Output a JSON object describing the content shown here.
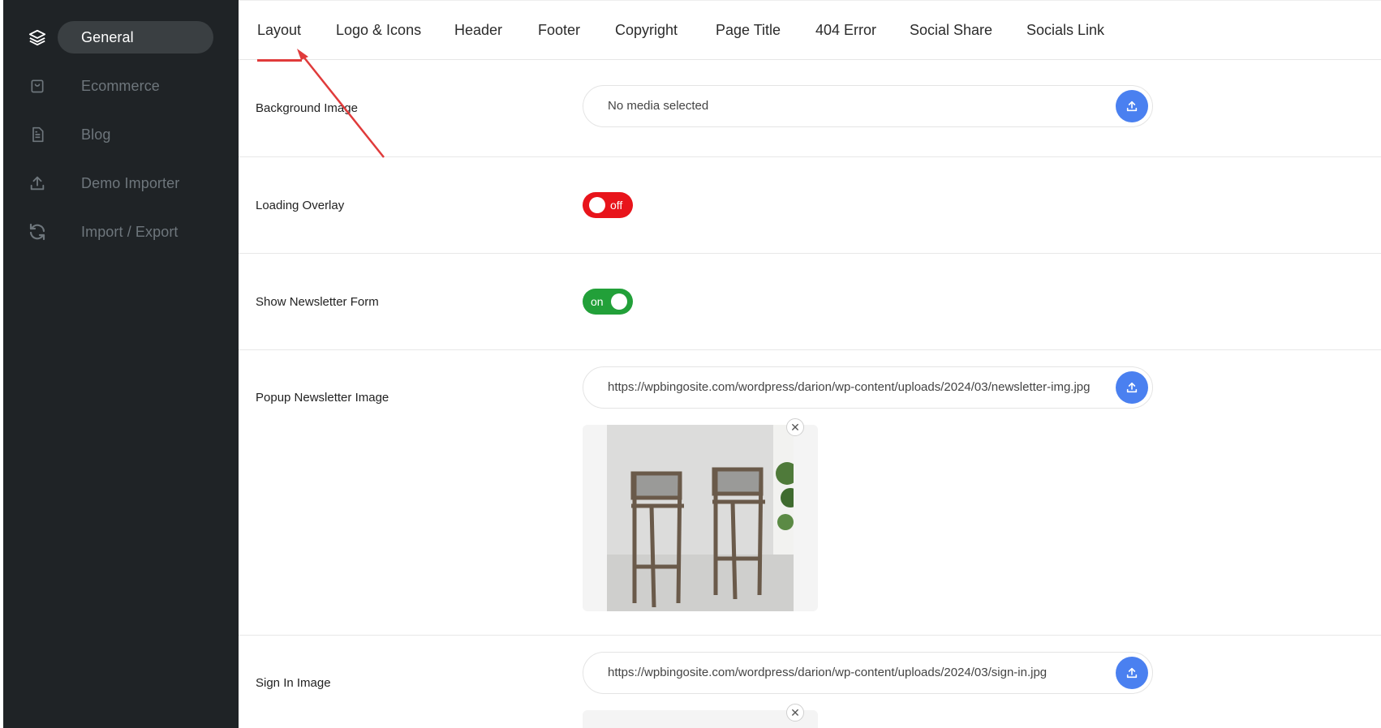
{
  "sidebar": {
    "items": [
      {
        "label": "General",
        "icon": "layers-icon",
        "active": true
      },
      {
        "label": "Ecommerce",
        "icon": "shopping-bag-icon",
        "active": false
      },
      {
        "label": "Blog",
        "icon": "document-icon",
        "active": false
      },
      {
        "label": "Demo Importer",
        "icon": "upload-icon",
        "active": false
      },
      {
        "label": "Import / Export",
        "icon": "refresh-icon",
        "active": false
      }
    ]
  },
  "tabs": [
    {
      "label": "Layout",
      "active": true
    },
    {
      "label": "Logo & Icons"
    },
    {
      "label": "Header"
    },
    {
      "label": "Footer"
    },
    {
      "label": "Copyright"
    },
    {
      "label": "Page Title"
    },
    {
      "label": "404 Error"
    },
    {
      "label": "Social Share"
    },
    {
      "label": "Socials Link"
    }
  ],
  "settings": {
    "background_image": {
      "label": "Background Image",
      "value": "No media selected"
    },
    "loading_overlay": {
      "label": "Loading Overlay",
      "state": "off"
    },
    "show_newsletter": {
      "label": "Show Newsletter Form",
      "state": "on"
    },
    "popup_newsletter_image": {
      "label": "Popup Newsletter Image",
      "value": "https://wpbingosite.com/wordpress/darion/wp-content/uploads/2024/03/newsletter-img.jpg"
    },
    "sign_in_image": {
      "label": "Sign In Image",
      "value": "https://wpbingosite.com/wordpress/darion/wp-content/uploads/2024/03/sign-in.jpg"
    }
  },
  "colors": {
    "sidebar_bg": "#1f2326",
    "accent_blue": "#4a80f0",
    "toggle_off": "#e8141b",
    "toggle_on": "#22a039",
    "annotation_arrow": "#e03b3b"
  }
}
